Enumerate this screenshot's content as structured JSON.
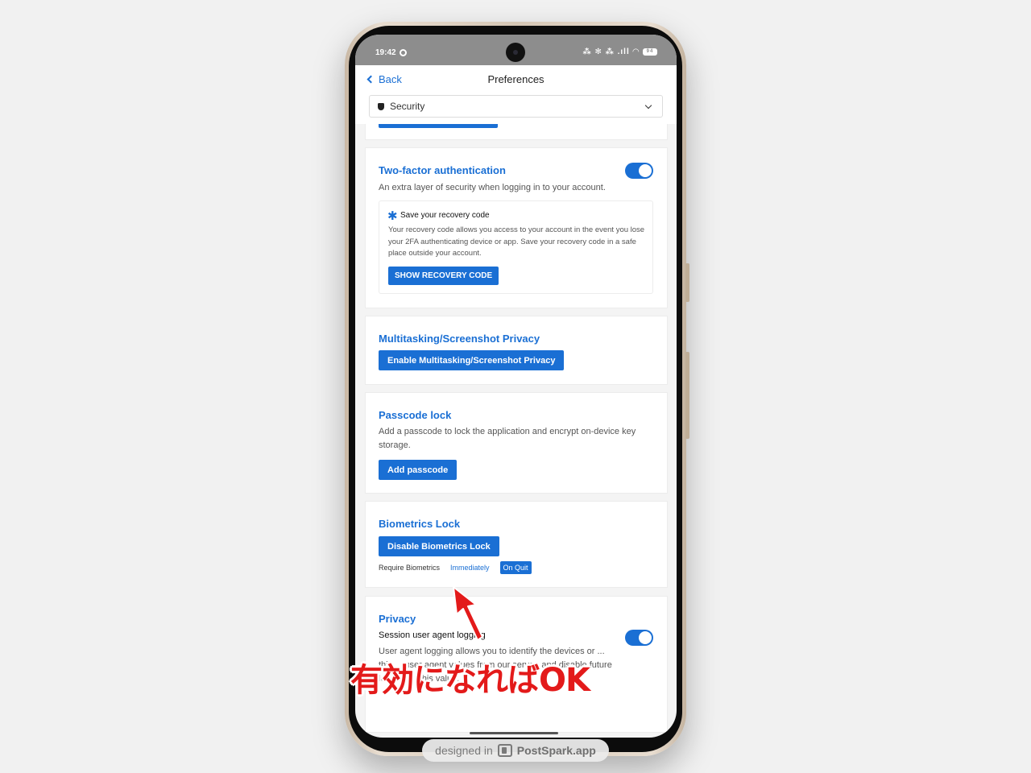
{
  "status": {
    "time": "19:42",
    "icons_text": "⁂ ✻ ⁂ .ıll ◠",
    "battery": "94"
  },
  "header": {
    "back_label": "Back",
    "title": "Preferences"
  },
  "section_select": {
    "value": "Security"
  },
  "two_factor": {
    "title": "Two-factor authentication",
    "description": "An extra layer of security when logging in to your account.",
    "recovery_title": "Save your recovery code",
    "recovery_description": "Your recovery code allows you access to your account in the event you lose your 2FA authenticating device or app. Save your recovery code in a safe place outside your account.",
    "recovery_button": "SHOW RECOVERY CODE",
    "enabled": true
  },
  "multitasking": {
    "title": "Multitasking/Screenshot Privacy",
    "button": "Enable Multitasking/Screenshot Privacy"
  },
  "passcode": {
    "title": "Passcode lock",
    "description": "Add a passcode to lock the application and encrypt on-device key storage.",
    "button": "Add passcode"
  },
  "biometrics": {
    "title": "Biometrics Lock",
    "button": "Disable Biometrics Lock",
    "require_label": "Require Biometrics",
    "option_immediately": "Immediately",
    "option_on_quit": "On Quit",
    "selected": "On Quit"
  },
  "privacy": {
    "title": "Privacy",
    "setting_label": "Session user agent logging",
    "description": "User agent logging allows you to identify the devices or ... this ... user agent values from our server, and disable future logging of this value.",
    "enabled": true
  },
  "annotation": {
    "text": "有効になればOK",
    "color": "#e31a1a"
  },
  "watermark": {
    "prefix": "designed in",
    "brand": "PostSpark.app"
  },
  "colors": {
    "accent": "#1a6fd4",
    "annotation": "#e31a1a"
  }
}
